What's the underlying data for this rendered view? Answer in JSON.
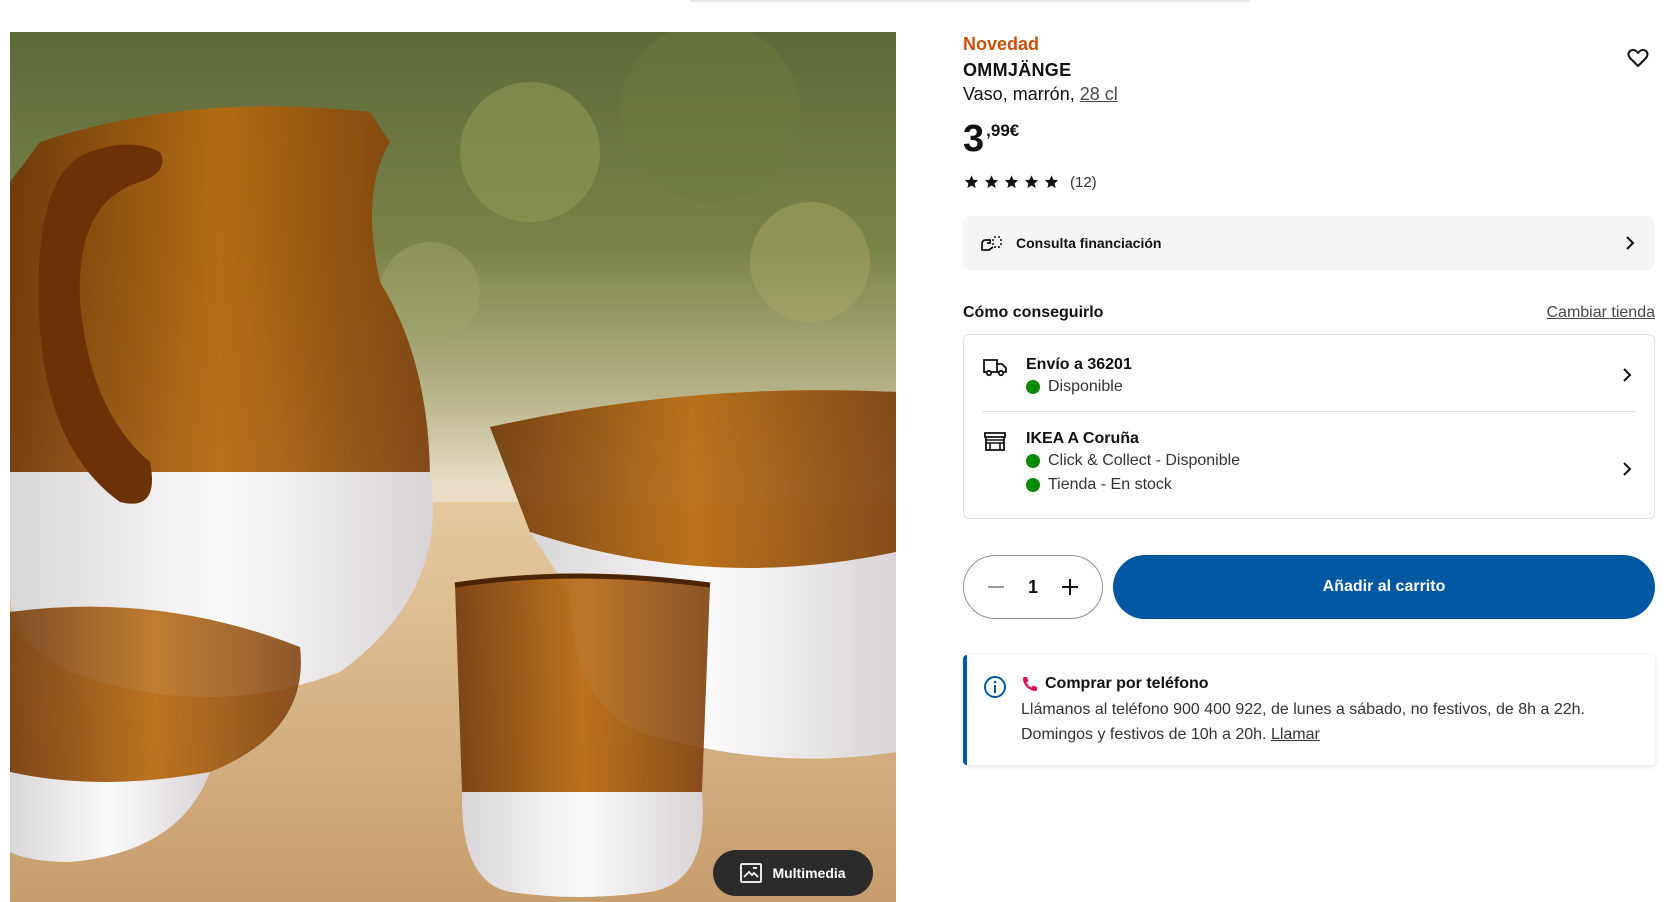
{
  "product": {
    "badge": "Novedad",
    "name": "OMMJÄNGE",
    "description": "Vaso, marrón,",
    "size": "28 cl",
    "price_integer": "3",
    "price_decimal": ",99€",
    "rating_count": "(12)",
    "rating_stars": 5
  },
  "media": {
    "button_label": "Multimedia"
  },
  "finance": {
    "label": "Consulta financiación"
  },
  "availability": {
    "title": "Cómo conseguirlo",
    "change_store": "Cambiar tienda",
    "delivery": {
      "title": "Envío a 36201",
      "status": "Disponible"
    },
    "store": {
      "title": "IKEA A Coruña",
      "status_collect": "Click & Collect - Disponible",
      "status_store": "Tienda - En stock"
    }
  },
  "cart": {
    "quantity": "1",
    "add_label": "Añadir al carrito"
  },
  "phone": {
    "title": "Comprar por teléfono",
    "text_line1": "Llámanos al teléfono 900 400 922, de lunes a sábado, no festivos, de 8h a 22h.",
    "text_line2": "Domingos y festivos de 10h a 20h.",
    "call_link": "Llamar"
  },
  "colors": {
    "accent_blue": "#0058a3",
    "badge_orange": "#ca5008",
    "available_green": "#0a8a00",
    "amber_glass": "#8a4a12"
  }
}
